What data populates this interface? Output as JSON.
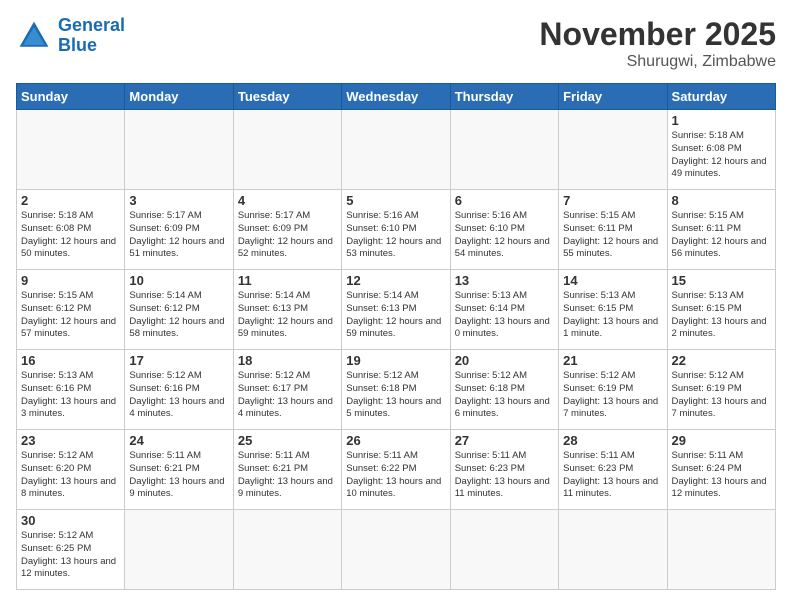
{
  "header": {
    "logo_general": "General",
    "logo_blue": "Blue",
    "month_title": "November 2025",
    "location": "Shurugwi, Zimbabwe"
  },
  "days_of_week": [
    "Sunday",
    "Monday",
    "Tuesday",
    "Wednesday",
    "Thursday",
    "Friday",
    "Saturday"
  ],
  "weeks": [
    [
      {
        "day": "",
        "info": ""
      },
      {
        "day": "",
        "info": ""
      },
      {
        "day": "",
        "info": ""
      },
      {
        "day": "",
        "info": ""
      },
      {
        "day": "",
        "info": ""
      },
      {
        "day": "",
        "info": ""
      },
      {
        "day": "1",
        "info": "Sunrise: 5:18 AM\nSunset: 6:08 PM\nDaylight: 12 hours\nand 49 minutes."
      }
    ],
    [
      {
        "day": "2",
        "info": "Sunrise: 5:18 AM\nSunset: 6:08 PM\nDaylight: 12 hours\nand 50 minutes."
      },
      {
        "day": "3",
        "info": "Sunrise: 5:17 AM\nSunset: 6:09 PM\nDaylight: 12 hours\nand 51 minutes."
      },
      {
        "day": "4",
        "info": "Sunrise: 5:17 AM\nSunset: 6:09 PM\nDaylight: 12 hours\nand 52 minutes."
      },
      {
        "day": "5",
        "info": "Sunrise: 5:16 AM\nSunset: 6:10 PM\nDaylight: 12 hours\nand 53 minutes."
      },
      {
        "day": "6",
        "info": "Sunrise: 5:16 AM\nSunset: 6:10 PM\nDaylight: 12 hours\nand 54 minutes."
      },
      {
        "day": "7",
        "info": "Sunrise: 5:15 AM\nSunset: 6:11 PM\nDaylight: 12 hours\nand 55 minutes."
      },
      {
        "day": "8",
        "info": "Sunrise: 5:15 AM\nSunset: 6:11 PM\nDaylight: 12 hours\nand 56 minutes."
      }
    ],
    [
      {
        "day": "9",
        "info": "Sunrise: 5:15 AM\nSunset: 6:12 PM\nDaylight: 12 hours\nand 57 minutes."
      },
      {
        "day": "10",
        "info": "Sunrise: 5:14 AM\nSunset: 6:12 PM\nDaylight: 12 hours\nand 58 minutes."
      },
      {
        "day": "11",
        "info": "Sunrise: 5:14 AM\nSunset: 6:13 PM\nDaylight: 12 hours\nand 59 minutes."
      },
      {
        "day": "12",
        "info": "Sunrise: 5:14 AM\nSunset: 6:13 PM\nDaylight: 12 hours\nand 59 minutes."
      },
      {
        "day": "13",
        "info": "Sunrise: 5:13 AM\nSunset: 6:14 PM\nDaylight: 13 hours\nand 0 minutes."
      },
      {
        "day": "14",
        "info": "Sunrise: 5:13 AM\nSunset: 6:15 PM\nDaylight: 13 hours\nand 1 minute."
      },
      {
        "day": "15",
        "info": "Sunrise: 5:13 AM\nSunset: 6:15 PM\nDaylight: 13 hours\nand 2 minutes."
      }
    ],
    [
      {
        "day": "16",
        "info": "Sunrise: 5:13 AM\nSunset: 6:16 PM\nDaylight: 13 hours\nand 3 minutes."
      },
      {
        "day": "17",
        "info": "Sunrise: 5:12 AM\nSunset: 6:16 PM\nDaylight: 13 hours\nand 4 minutes."
      },
      {
        "day": "18",
        "info": "Sunrise: 5:12 AM\nSunset: 6:17 PM\nDaylight: 13 hours\nand 4 minutes."
      },
      {
        "day": "19",
        "info": "Sunrise: 5:12 AM\nSunset: 6:18 PM\nDaylight: 13 hours\nand 5 minutes."
      },
      {
        "day": "20",
        "info": "Sunrise: 5:12 AM\nSunset: 6:18 PM\nDaylight: 13 hours\nand 6 minutes."
      },
      {
        "day": "21",
        "info": "Sunrise: 5:12 AM\nSunset: 6:19 PM\nDaylight: 13 hours\nand 7 minutes."
      },
      {
        "day": "22",
        "info": "Sunrise: 5:12 AM\nSunset: 6:19 PM\nDaylight: 13 hours\nand 7 minutes."
      }
    ],
    [
      {
        "day": "23",
        "info": "Sunrise: 5:12 AM\nSunset: 6:20 PM\nDaylight: 13 hours\nand 8 minutes."
      },
      {
        "day": "24",
        "info": "Sunrise: 5:11 AM\nSunset: 6:21 PM\nDaylight: 13 hours\nand 9 minutes."
      },
      {
        "day": "25",
        "info": "Sunrise: 5:11 AM\nSunset: 6:21 PM\nDaylight: 13 hours\nand 9 minutes."
      },
      {
        "day": "26",
        "info": "Sunrise: 5:11 AM\nSunset: 6:22 PM\nDaylight: 13 hours\nand 10 minutes."
      },
      {
        "day": "27",
        "info": "Sunrise: 5:11 AM\nSunset: 6:23 PM\nDaylight: 13 hours\nand 11 minutes."
      },
      {
        "day": "28",
        "info": "Sunrise: 5:11 AM\nSunset: 6:23 PM\nDaylight: 13 hours\nand 11 minutes."
      },
      {
        "day": "29",
        "info": "Sunrise: 5:11 AM\nSunset: 6:24 PM\nDaylight: 13 hours\nand 12 minutes."
      }
    ],
    [
      {
        "day": "30",
        "info": "Sunrise: 5:12 AM\nSunset: 6:25 PM\nDaylight: 13 hours\nand 12 minutes."
      },
      {
        "day": "",
        "info": ""
      },
      {
        "day": "",
        "info": ""
      },
      {
        "day": "",
        "info": ""
      },
      {
        "day": "",
        "info": ""
      },
      {
        "day": "",
        "info": ""
      },
      {
        "day": "",
        "info": ""
      }
    ]
  ]
}
